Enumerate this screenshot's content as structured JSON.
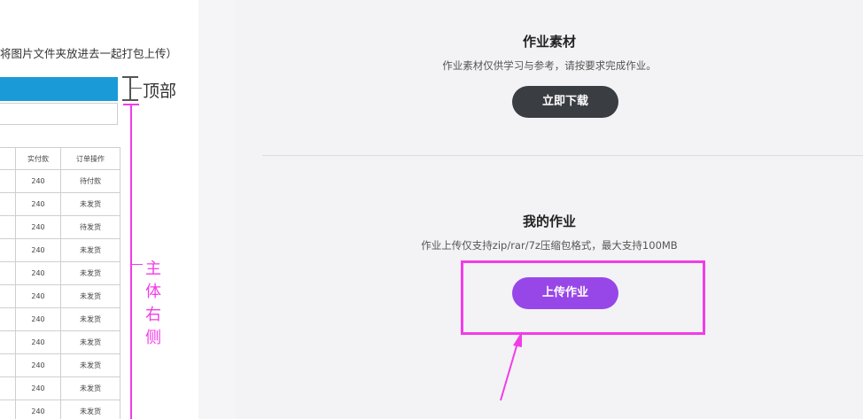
{
  "left": {
    "instruction": "将图片文件夹放进去一起打包上传）",
    "table": {
      "headers": [
        "",
        "实付款",
        "订单操作"
      ],
      "rows": [
        [
          "",
          "240",
          "待付款"
        ],
        [
          "",
          "240",
          "未发货"
        ],
        [
          "",
          "240",
          "待发货"
        ],
        [
          "",
          "240",
          "未发货"
        ],
        [
          "",
          "240",
          "未发货"
        ],
        [
          "",
          "240",
          "未发货"
        ],
        [
          "",
          "240",
          "未发货"
        ],
        [
          "",
          "240",
          "未发货"
        ],
        [
          "",
          "240",
          "未发货"
        ],
        [
          "",
          "240",
          "未发货"
        ],
        [
          "",
          "240",
          "未发货"
        ]
      ]
    },
    "annotations": {
      "top_label": "顶部",
      "body_label": "主体右侧"
    }
  },
  "materials": {
    "title": "作业素材",
    "description": "作业素材仅供学习与参考，请按要求完成作业。",
    "download_button": "立即下载"
  },
  "homework": {
    "title": "我的作业",
    "description": "作业上传仅支持zip/rar/7z压缩包格式，最大支持100MB",
    "upload_button": "上传作业"
  },
  "colors": {
    "download_button": "#3a3d42",
    "upload_button": "#9747e8",
    "annotation": "#f23ce8",
    "mock_header": "#1a9bd7"
  },
  "icons": {
    "drag_handle": "drag-handle-icon",
    "arrow": "annotation-arrow-icon"
  }
}
